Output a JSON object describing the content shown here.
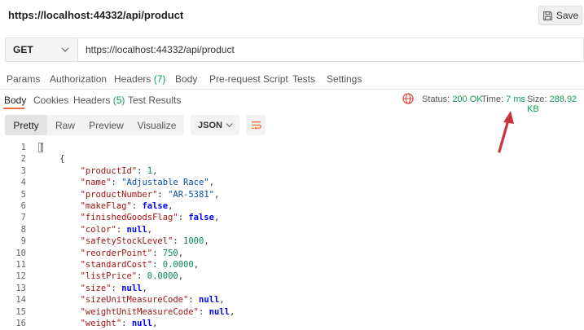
{
  "title": {
    "url": "https://localhost:44332/api/product",
    "save_label": "Save"
  },
  "request": {
    "method": "GET",
    "url": "https://localhost:44332/api/product"
  },
  "request_tabs": [
    {
      "label": "Params"
    },
    {
      "label": "Authorization"
    },
    {
      "label": "Headers",
      "count": "(7)"
    },
    {
      "label": "Body"
    },
    {
      "label": "Pre-request Script"
    },
    {
      "label": "Tests"
    },
    {
      "label": "Settings"
    }
  ],
  "response_tabs": [
    {
      "label": "Body"
    },
    {
      "label": "Cookies"
    },
    {
      "label": "Headers",
      "count": "(5)"
    },
    {
      "label": "Test Results"
    }
  ],
  "status": {
    "status_label": "Status:",
    "status_value": "200 OK",
    "time_label": "Time:",
    "time_value": "7 ms",
    "size_label": "Size:",
    "size_value": "288.92 KB"
  },
  "view_modes": [
    "Pretty",
    "Raw",
    "Preview",
    "Visualize"
  ],
  "format": "JSON",
  "colors": {
    "accent": "#f26b3a",
    "success": "#0f9d58",
    "annotation": "#c8353a"
  },
  "code_lines": [
    {
      "n": "1",
      "t": "["
    },
    {
      "n": "2",
      "t": "    {"
    },
    {
      "n": "3",
      "key": "\"productId\"",
      "val": "1",
      "vt": "n"
    },
    {
      "n": "4",
      "key": "\"name\"",
      "val": "\"Adjustable Race\"",
      "vt": "s"
    },
    {
      "n": "5",
      "key": "\"productNumber\"",
      "val": "\"AR-5381\"",
      "vt": "s"
    },
    {
      "n": "6",
      "key": "\"makeFlag\"",
      "val": "false",
      "vt": "lit"
    },
    {
      "n": "7",
      "key": "\"finishedGoodsFlag\"",
      "val": "false",
      "vt": "lit"
    },
    {
      "n": "8",
      "key": "\"color\"",
      "val": "null",
      "vt": "lit"
    },
    {
      "n": "9",
      "key": "\"safetyStockLevel\"",
      "val": "1000",
      "vt": "n"
    },
    {
      "n": "10",
      "key": "\"reorderPoint\"",
      "val": "750",
      "vt": "n"
    },
    {
      "n": "11",
      "key": "\"standardCost\"",
      "val": "0.0000",
      "vt": "n"
    },
    {
      "n": "12",
      "key": "\"listPrice\"",
      "val": "0.0000",
      "vt": "n"
    },
    {
      "n": "13",
      "key": "\"size\"",
      "val": "null",
      "vt": "lit"
    },
    {
      "n": "14",
      "key": "\"sizeUnitMeasureCode\"",
      "val": "null",
      "vt": "lit"
    },
    {
      "n": "15",
      "key": "\"weightUnitMeasureCode\"",
      "val": "null",
      "vt": "lit"
    },
    {
      "n": "16",
      "key": "\"weight\"",
      "val": "null",
      "vt": "lit"
    }
  ]
}
